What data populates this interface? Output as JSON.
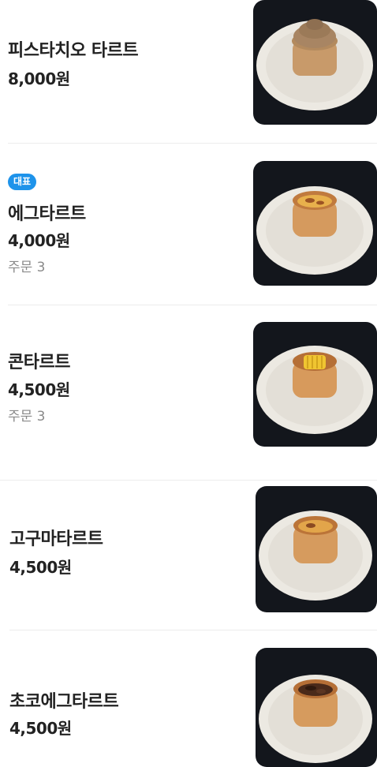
{
  "colors": {
    "badge_background": "#1e93ea",
    "order_count_text": "#8a8a8a",
    "thumbnail_background": "#13161c"
  },
  "menu": {
    "items": [
      {
        "name": "피스타치오 타르트",
        "price": "8,000원",
        "topping_icon": "cream-swirl-icon"
      },
      {
        "badge": "대표",
        "name": "에그타르트",
        "price": "4,000원",
        "orders": "주문 3",
        "topping_icon": "custard-icon"
      },
      {
        "name": "콘타르트",
        "price": "4,500원",
        "orders": "주문 3",
        "topping_icon": "corn-icon"
      },
      {
        "name": "고구마타르트",
        "price": "4,500원",
        "topping_icon": "sweet-potato-icon"
      },
      {
        "name": "초코에그타르트",
        "price": "4,500원",
        "topping_icon": "chocolate-icon"
      }
    ]
  }
}
